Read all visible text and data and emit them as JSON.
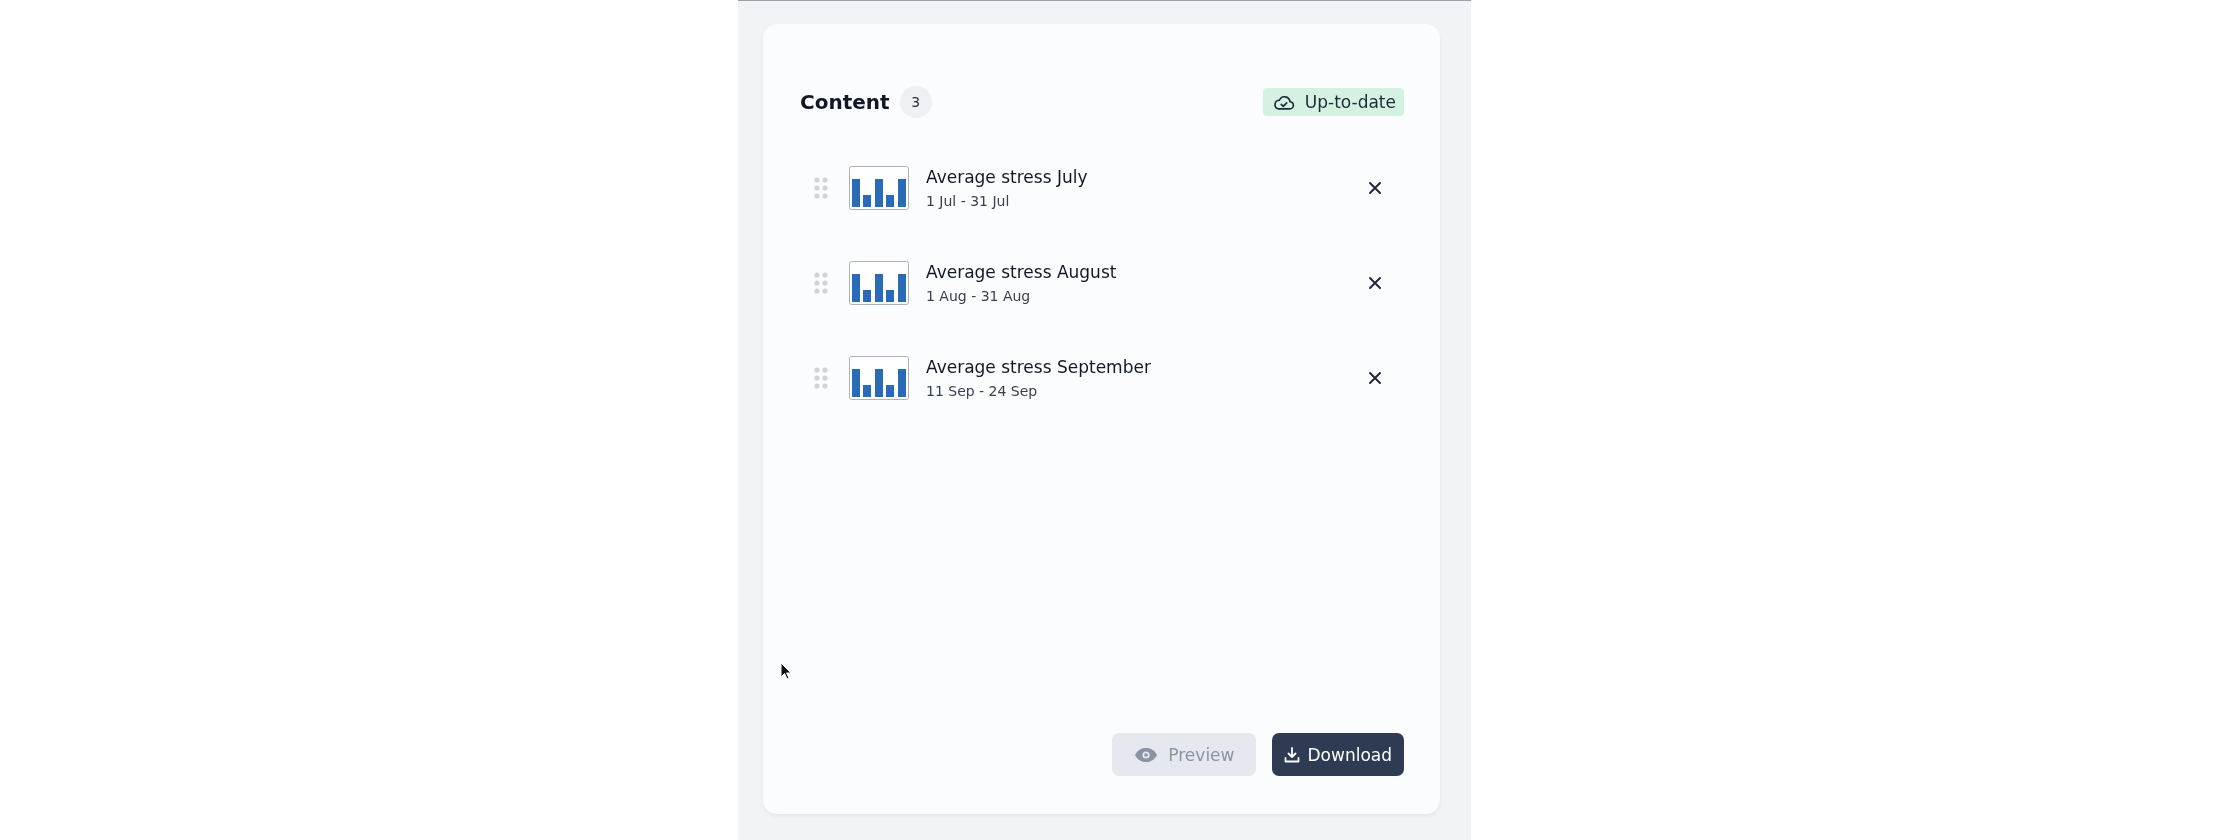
{
  "content": {
    "title": "Content",
    "count": "3",
    "status": "Up-to-date",
    "items": [
      {
        "title": "Average stress July",
        "range": "1 Jul - 31 Jul"
      },
      {
        "title": "Average stress August",
        "range": "1 Aug - 31 Aug"
      },
      {
        "title": "Average stress September",
        "range": "11 Sep - 24 Sep"
      }
    ],
    "buttons": [
      {
        "label": "Preview",
        "kind": "preview",
        "disabled": true
      },
      {
        "label": "Download",
        "kind": "download",
        "disabled": false
      }
    ]
  }
}
